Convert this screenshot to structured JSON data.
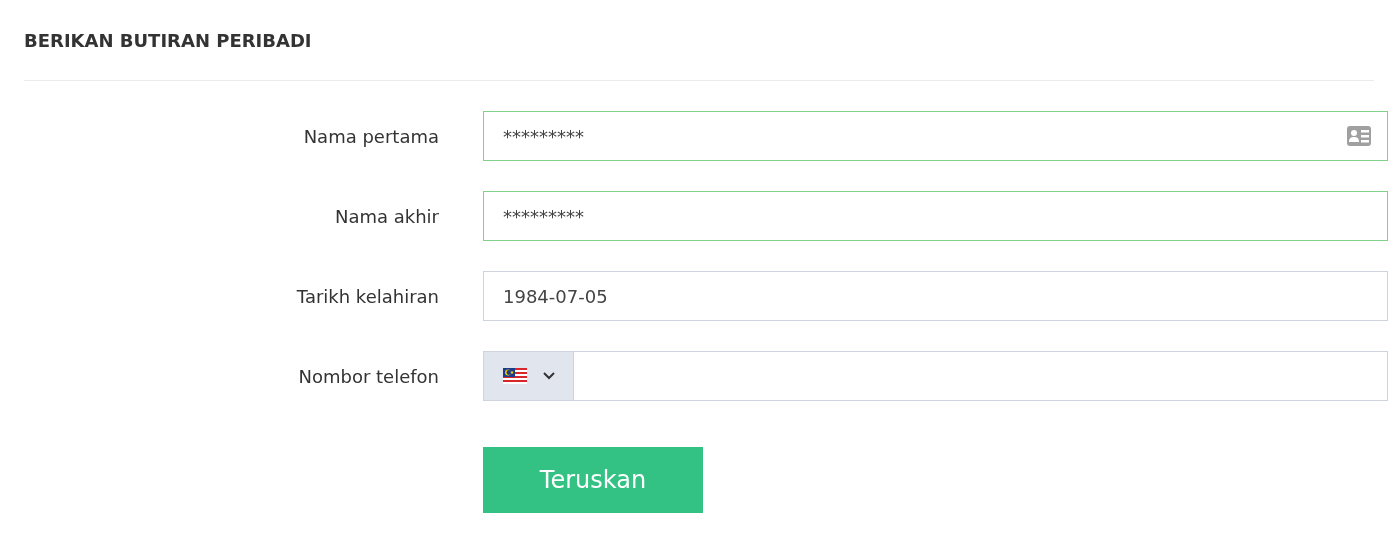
{
  "title": "BERIKAN BUTIRAN PERIBADI",
  "fields": [
    {
      "kind": "card",
      "label": "Nama pertama",
      "value": "*********",
      "valid": true
    },
    {
      "kind": "text",
      "label": "Nama akhir",
      "value": "*********",
      "valid": true
    },
    {
      "kind": "text",
      "label": "Tarikh kelahiran",
      "value": "1984-07-05",
      "valid": false
    },
    {
      "kind": "phone",
      "label": "Nombor telefon",
      "valid": false
    }
  ],
  "submit": "Teruskan"
}
